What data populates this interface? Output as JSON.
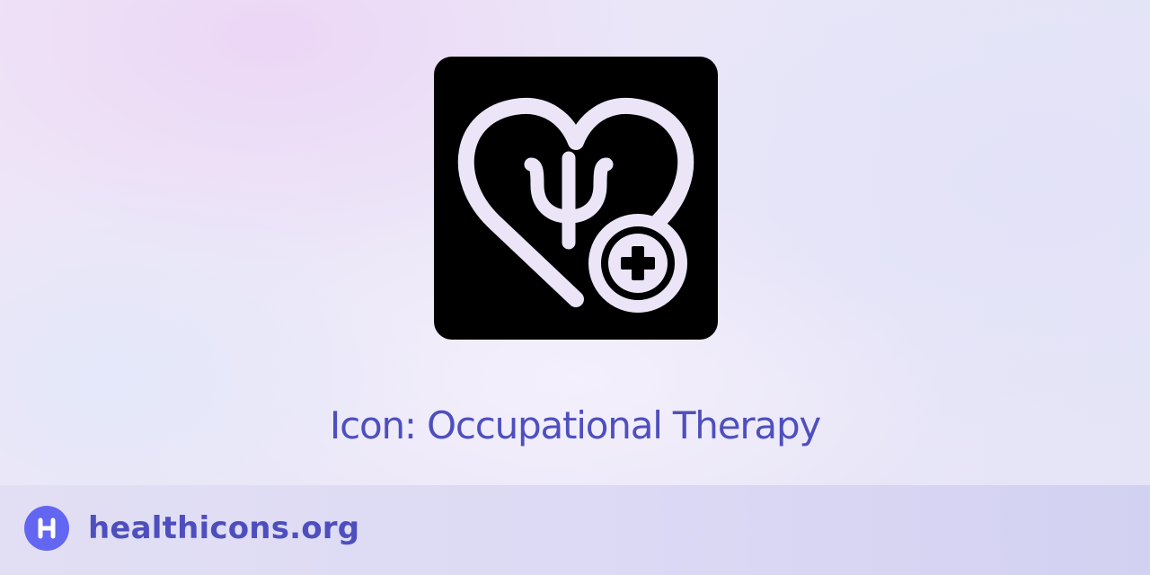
{
  "icon": {
    "name": "occupational-therapy-icon",
    "background_color": "#000000",
    "glyph_color": "#ebe5f7"
  },
  "caption": {
    "text": "Icon: Occupational Therapy",
    "color": "#4e4fbe"
  },
  "footer": {
    "brand_name": "healthicons.org",
    "brand_color": "#4e4fbe",
    "logo_icon": "healthicons-logo-icon",
    "logo_letter": "H",
    "logo_color": "#6366f1"
  }
}
